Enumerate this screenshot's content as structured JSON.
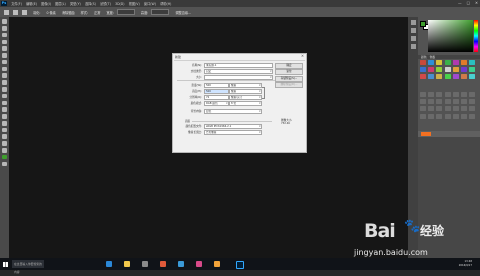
{
  "app": {
    "logo_text": "Ps"
  },
  "menubar": {
    "items": [
      "文件(F)",
      "编辑(E)",
      "图像(I)",
      "图层(L)",
      "类型(Y)",
      "选择(S)",
      "滤镜(T)",
      "3D(D)",
      "视图(V)",
      "窗口(W)",
      "帮助(H)"
    ],
    "window_controls": [
      "—",
      "□",
      "✕"
    ]
  },
  "options_bar": {
    "feather_label": "羽化:",
    "feather_value": "0 像素",
    "antialias_label": "消除锯齿",
    "style_label": "样式:",
    "style_value": "正常",
    "width_label": "宽度:",
    "height_label": "高度:",
    "refine_edge": "调整边缘..."
  },
  "panels": {
    "tabs": [
      "颜色",
      "色板"
    ],
    "foreground_color": "#3f9e2e",
    "background_color": "#ffffff",
    "layers_tab_color": "#f37021"
  },
  "dialog": {
    "title": "新建",
    "close": "✕",
    "name_label": "名称(N):",
    "name_value": "未标题-1",
    "preset_label": "文档类型:",
    "preset_value": "自定",
    "size_label": "大小:",
    "width_label": "宽度(W):",
    "width_value": "500",
    "width_unit": "像素",
    "height_label": "高度(H):",
    "height_value": "500",
    "height_unit": "像素",
    "resolution_label": "分辨率(R):",
    "resolution_value": "72",
    "resolution_unit": "像素/英寸",
    "color_mode_label": "颜色模式:",
    "color_mode_value": "RGB 颜色",
    "bit_depth_value": "8 位",
    "background_label": "背景内容:",
    "background_value": "白色",
    "advanced_label": "高级",
    "profile_label": "颜色配置文件:",
    "profile_value": "sRGB IEC61966-2.1",
    "aspect_label": "像素长宽比:",
    "aspect_value": "方形像素",
    "buttons": {
      "ok": "确定",
      "reset": "复位",
      "save_preset": "存储预设(S)...",
      "delete_preset": "删除预设(D)..."
    },
    "image_size_label": "图像大小:",
    "image_size_value": "732.4K"
  },
  "taskbar": {
    "search_placeholder": "在这里输入你要搜索的内容",
    "time": "13:48",
    "date": "2016/9/17"
  },
  "watermark": {
    "logo": "Bai",
    "brand": "经验",
    "url": "jingyan.baidu.com"
  }
}
